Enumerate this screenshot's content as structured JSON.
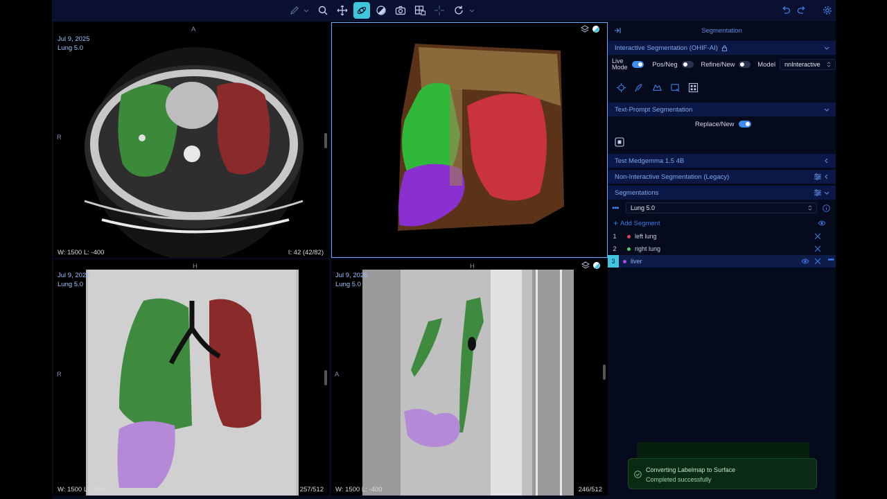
{
  "toolbar": {
    "tools": [
      "pencil-icon",
      "search-icon",
      "pan-icon",
      "3d-rotate-icon",
      "contrast-icon",
      "camera-icon",
      "layout-icon",
      "crosshair-icon",
      "reset-icon"
    ],
    "accent": "#3fc6dd"
  },
  "viewports": {
    "axial": {
      "date": "Jul 9, 2025",
      "series": "Lung 5.0",
      "top_marker": "A",
      "left_marker": "R",
      "wl": "W: 1500  L: -400",
      "slice": "I: 42 (42/82)"
    },
    "volume": {},
    "coronal": {
      "date": "Jul 9, 2025",
      "series": "Lung 5.0",
      "top_marker": "H",
      "left_marker": "R",
      "wl": "W: 1500  L: -400",
      "slice": "257/512"
    },
    "sagittal": {
      "date": "Jul 9, 2025",
      "series": "Lung 5.0",
      "top_marker": "H",
      "left_marker": "A",
      "wl": "W: 1500  L: -400",
      "slice": "246/512"
    }
  },
  "panel": {
    "title": "Segmentation",
    "interactive": {
      "title": "Interactive Segmentation (OHIF-AI)",
      "live_mode_l1": "Live",
      "live_mode_l2": "Mode",
      "posneg": "Pos/Neg",
      "refine": "Refine/New",
      "model_label": "Model",
      "model_value": "nnInteractive"
    },
    "text_prompt": {
      "title": "Text-Prompt Segmentation",
      "replace": "Replace/New"
    },
    "medgemma": "Test Medgemma 1.5 4B",
    "legacy": "Non-Interactive Segmentation (Legacy)",
    "segmentations": {
      "title": "Segmentations",
      "selected": "Lung 5.0",
      "add": "Add Segment",
      "items": [
        {
          "num": "1",
          "label": "left lung",
          "color": "#e0475a"
        },
        {
          "num": "2",
          "label": "right lung",
          "color": "#4cd36a"
        },
        {
          "num": "3",
          "label": "liver",
          "color": "#b04be0"
        }
      ]
    }
  },
  "toast": {
    "title": "Converting Labelmap to Surface",
    "message": "Completed successfully"
  }
}
